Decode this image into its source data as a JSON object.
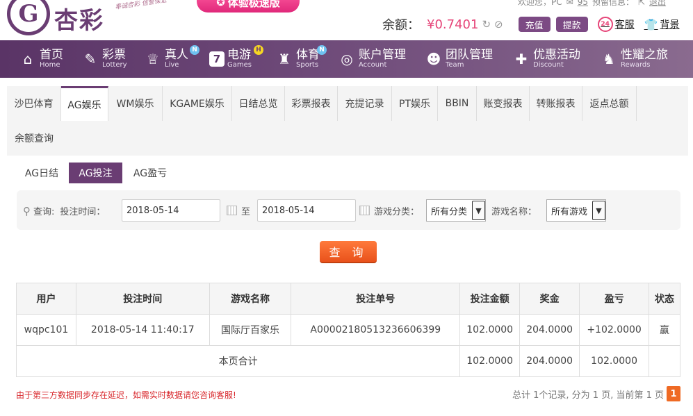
{
  "header": {
    "logo_glyph": "G",
    "logo_text": "杏彩",
    "slogan": "奉诚杏彩 信誉保证",
    "promo_label": "体验极速版",
    "welcome": "欢迎您，PC",
    "mail_count": "95",
    "notice_label": "预留信息：",
    "logout": "退出",
    "balance_label": "余额：",
    "balance_value": "¥0.7401",
    "deposit": "充值",
    "withdraw": "提款",
    "cs_badge": "24",
    "customer_service": "客服",
    "background": "背景"
  },
  "nav": [
    {
      "title": "首页",
      "sub": "Home",
      "icon": "home-icon",
      "glyph": "⌂",
      "badge": ""
    },
    {
      "title": "彩票",
      "sub": "Lottery",
      "icon": "ticket-icon",
      "glyph": "✎",
      "badge": ""
    },
    {
      "title": "真人",
      "sub": "Live",
      "icon": "dealer-icon",
      "glyph": "♕",
      "badge": "N"
    },
    {
      "title": "电游",
      "sub": "Games",
      "icon": "slot-icon",
      "glyph": "7",
      "badge": "H"
    },
    {
      "title": "体育",
      "sub": "Sports",
      "icon": "trophy-icon",
      "glyph": "♜",
      "badge": "N"
    },
    {
      "title": "账户管理",
      "sub": "Account",
      "icon": "account-icon",
      "glyph": "◎",
      "badge": ""
    },
    {
      "title": "团队管理",
      "sub": "Team",
      "icon": "team-icon",
      "glyph": "☻",
      "badge": ""
    },
    {
      "title": "优惠活动",
      "sub": "Discount",
      "icon": "gift-icon",
      "glyph": "✚",
      "badge": ""
    },
    {
      "title": "性耀之旅",
      "sub": "Rewards",
      "icon": "rewards-icon",
      "glyph": "♞",
      "badge": ""
    }
  ],
  "tabs": [
    {
      "label": "沙巴体育"
    },
    {
      "label": "AG娱乐",
      "active": true
    },
    {
      "label": "WM娱乐"
    },
    {
      "label": "KGAME娱乐"
    },
    {
      "label": "日结总览"
    },
    {
      "label": "彩票报表"
    },
    {
      "label": "充提记录"
    },
    {
      "label": "PT娱乐"
    },
    {
      "label": "BBIN"
    },
    {
      "label": "账变报表"
    },
    {
      "label": "转账报表"
    },
    {
      "label": "返点总额"
    },
    {
      "label": "余额查询"
    }
  ],
  "subtabs": [
    {
      "label": "AG日结"
    },
    {
      "label": "AG投注",
      "active": true
    },
    {
      "label": "AG盈亏"
    }
  ],
  "filter": {
    "query_label": "查询:",
    "time_label": "投注时间：",
    "start_date": "2018-05-14",
    "to_label": "至",
    "end_date": "2018-05-14",
    "category_label": "游戏分类：",
    "category_value": "所有分类",
    "game_label": "游戏名称：",
    "game_value": "所有游戏"
  },
  "query_button": "查 询",
  "table": {
    "headers": [
      "用户",
      "投注时间",
      "游戏名称",
      "投注单号",
      "投注金额",
      "奖金",
      "盈亏",
      "状态"
    ],
    "rows": [
      [
        "wqpc101",
        "2018-05-14 11:40:17",
        "国际厅百家乐",
        "A00002180513236606399",
        "102.0000",
        "204.0000",
        "+102.0000",
        "赢"
      ]
    ],
    "total_label": "本页合计",
    "total_bet": "102.0000",
    "total_bonus": "204.0000",
    "total_profit": "102.0000"
  },
  "note": "由于第三方数据同步存在延迟，如需实时数据请您咨询客服!",
  "pager": {
    "summary": "总计 1个记录, 分为 1 页, 当前第 1 页",
    "current": "1"
  },
  "colors": {
    "brand": "#6a3d73",
    "accent": "#e64478",
    "query": "#e9521b",
    "win": "#2e8a2a",
    "note": "#d8272c"
  }
}
